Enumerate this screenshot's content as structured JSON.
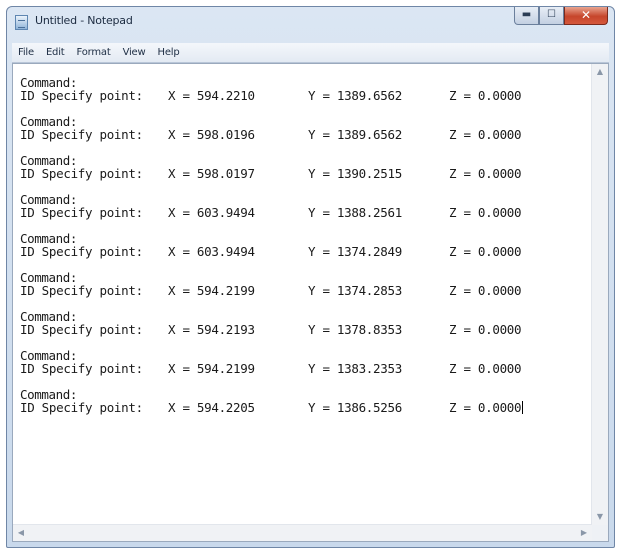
{
  "window": {
    "title": "Untitled - Notepad",
    "buttons": {
      "minimize": "▬",
      "maximize": "☐",
      "close": "✕"
    }
  },
  "menu": [
    "File",
    "Edit",
    "Format",
    "View",
    "Help"
  ],
  "entries": [
    {
      "command": "Command:",
      "label": "ID Specify point:",
      "x": "X = 594.2210",
      "y": "Y = 1389.6562",
      "z": "Z = 0.0000"
    },
    {
      "command": "Command:",
      "label": "ID Specify point:",
      "x": "X = 598.0196",
      "y": "Y = 1389.6562",
      "z": "Z = 0.0000"
    },
    {
      "command": "Command:",
      "label": "ID Specify point:",
      "x": "X = 598.0197",
      "y": "Y = 1390.2515",
      "z": "Z = 0.0000"
    },
    {
      "command": "Command:",
      "label": "ID Specify point:",
      "x": "X = 603.9494",
      "y": "Y = 1388.2561",
      "z": "Z = 0.0000"
    },
    {
      "command": "Command:",
      "label": "ID Specify point:",
      "x": "X = 603.9494",
      "y": "Y = 1374.2849",
      "z": "Z = 0.0000"
    },
    {
      "command": "Command:",
      "label": "ID Specify point:",
      "x": "X = 594.2199",
      "y": "Y = 1374.2853",
      "z": "Z = 0.0000"
    },
    {
      "command": "Command:",
      "label": "ID Specify point:",
      "x": "X = 594.2193",
      "y": "Y = 1378.8353",
      "z": "Z = 0.0000"
    },
    {
      "command": "Command:",
      "label": "ID Specify point:",
      "x": "X = 594.2199",
      "y": "Y = 1383.2353",
      "z": "Z = 0.0000"
    },
    {
      "command": "Command:",
      "label": "ID Specify point:",
      "x": "X = 594.2205",
      "y": "Y = 1386.5256",
      "z": "Z = 0.0000"
    }
  ],
  "scroll_arrows": {
    "up": "▲",
    "down": "▼",
    "left": "◀",
    "right": "▶"
  }
}
